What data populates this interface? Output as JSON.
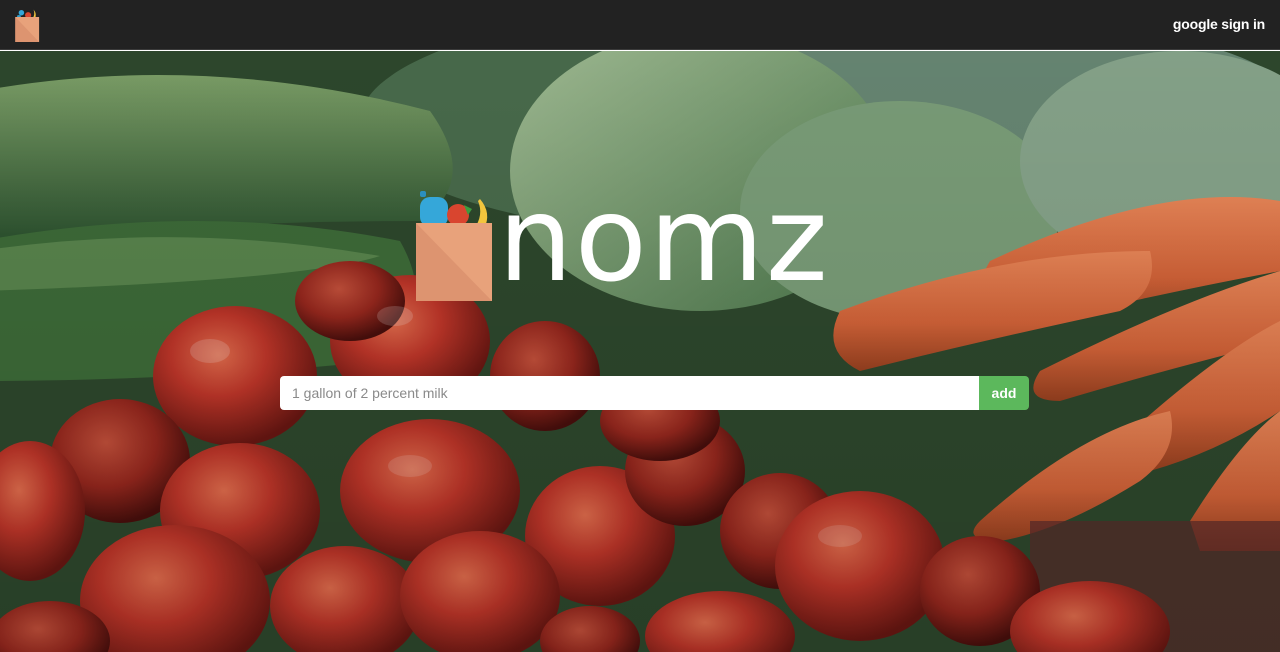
{
  "navbar": {
    "logo_icon": "grocery-bag-icon",
    "signin_label": "google sign in"
  },
  "hero": {
    "brand_name": "nomz",
    "brand_icon": "grocery-bag-icon",
    "background": "vegetables-photo"
  },
  "search": {
    "placeholder": "1 gallon of 2 percent milk",
    "value": "",
    "add_label": "add"
  },
  "colors": {
    "navbar_bg": "#222222",
    "add_button": "#5cb85c",
    "bag": "#e8a27b"
  }
}
